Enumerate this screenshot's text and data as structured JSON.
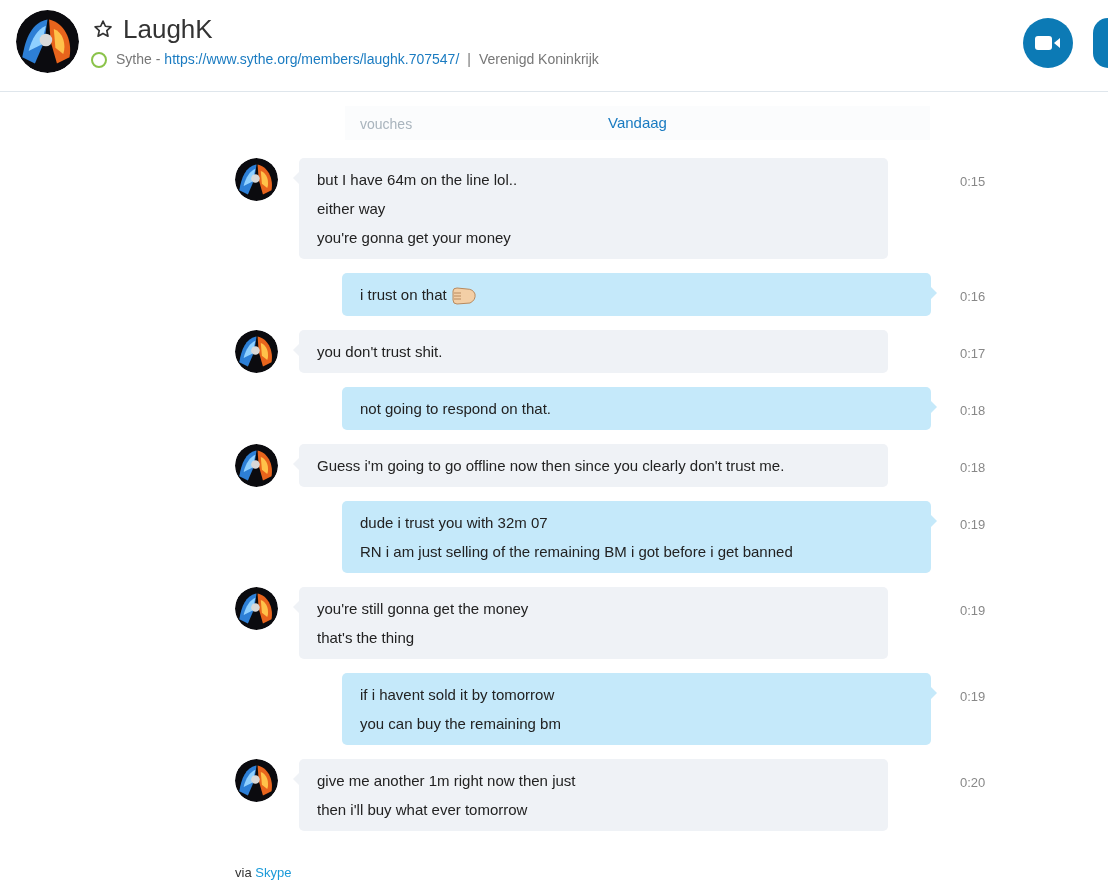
{
  "header": {
    "name": "LaughK",
    "favorite": false,
    "online": true,
    "source": "Sythe -",
    "link": "https://www.sythe.org/members/laughk.707547/",
    "separator": "|",
    "location": "Verenigd Koninkrijk"
  },
  "date_divider": {
    "faded_text": "vouches",
    "label": "Vandaag"
  },
  "messages": [
    {
      "kind": "incoming",
      "lines": [
        "but I have 64m on the line lol..",
        "either way",
        "you're gonna get your money"
      ],
      "time": "0:15"
    },
    {
      "kind": "outgoing",
      "lines": [
        "i trust on that"
      ],
      "emoji": true,
      "time": "0:16"
    },
    {
      "kind": "incoming",
      "lines": [
        "you don't trust shit."
      ],
      "time": "0:17"
    },
    {
      "kind": "outgoing",
      "lines": [
        "not going to respond on that."
      ],
      "time": "0:18"
    },
    {
      "kind": "incoming",
      "lines": [
        "Guess i'm going to go offline now then since you clearly don't trust me."
      ],
      "time": "0:18"
    },
    {
      "kind": "outgoing",
      "lines": [
        "dude i trust you with 32m 07",
        "RN i am just selling of the remaining BM i got before i get banned"
      ],
      "time": "0:19"
    },
    {
      "kind": "incoming",
      "lines": [
        "you're still gonna get the money",
        "that's the thing"
      ],
      "time": "0:19"
    },
    {
      "kind": "outgoing",
      "lines": [
        "if i havent sold it by tomorrow",
        "you can buy the remaining bm"
      ],
      "time": "0:19"
    },
    {
      "kind": "incoming",
      "lines": [
        "give me another 1m right now then just",
        "then i'll buy what ever tomorrow"
      ],
      "time": "0:20"
    }
  ],
  "footer": {
    "prefix": "via",
    "link": "Skype"
  }
}
